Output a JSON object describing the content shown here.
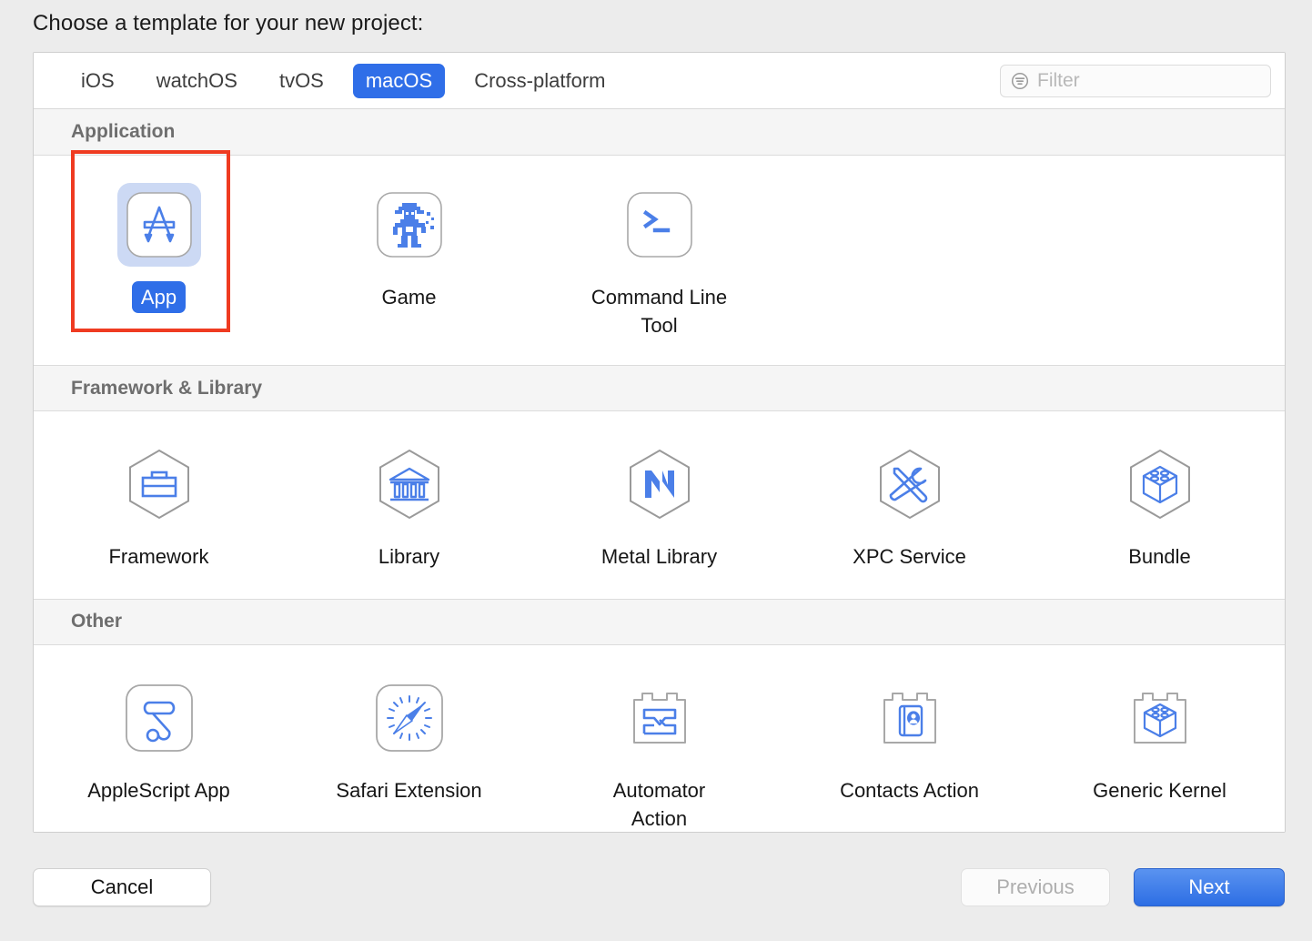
{
  "dialog": {
    "prompt": "Choose a template for your new project:"
  },
  "toolbar": {
    "tabs": [
      {
        "label": "iOS",
        "selected": false
      },
      {
        "label": "watchOS",
        "selected": false
      },
      {
        "label": "tvOS",
        "selected": false
      },
      {
        "label": "macOS",
        "selected": true
      },
      {
        "label": "Cross-platform",
        "selected": false
      }
    ],
    "filter": {
      "placeholder": "Filter",
      "value": "",
      "icon": "filter-icon"
    }
  },
  "sections": [
    {
      "title": "Application",
      "items": [
        {
          "label": "App",
          "icon": "app-store-icon",
          "selected": true
        },
        {
          "label": "Game",
          "icon": "game-sprite-icon",
          "selected": false
        },
        {
          "label": "Command Line Tool",
          "icon": "terminal-prompt-icon",
          "selected": false
        }
      ]
    },
    {
      "title": "Framework & Library",
      "items": [
        {
          "label": "Framework",
          "icon": "toolbox-hexagon-icon",
          "selected": false
        },
        {
          "label": "Library",
          "icon": "bank-hexagon-icon",
          "selected": false
        },
        {
          "label": "Metal Library",
          "icon": "metal-m-hexagon-icon",
          "selected": false
        },
        {
          "label": "XPC Service",
          "icon": "wrench-screwdriver-hexagon-icon",
          "selected": false
        },
        {
          "label": "Bundle",
          "icon": "brick-hexagon-icon",
          "selected": false
        }
      ]
    },
    {
      "title": "Other",
      "items": [
        {
          "label": "AppleScript App",
          "icon": "scroll-icon",
          "selected": false
        },
        {
          "label": "Safari Extension",
          "icon": "compass-icon",
          "selected": false
        },
        {
          "label": "Automator Action",
          "icon": "automator-plugin-icon",
          "selected": false
        },
        {
          "label": "Contacts Action",
          "icon": "contacts-plugin-icon",
          "selected": false
        },
        {
          "label": "Generic Kernel",
          "icon": "kernel-brick-plugin-icon",
          "selected": false
        }
      ]
    }
  ],
  "footer": {
    "cancel_label": "Cancel",
    "previous_label": "Previous",
    "next_label": "Next"
  },
  "colors": {
    "accent": "#2f6ee8",
    "annotation": "#ef3b21",
    "icon_blue": "#5180ea",
    "hex_outline": "#9a9a9a",
    "window_bg": "#ececec"
  }
}
